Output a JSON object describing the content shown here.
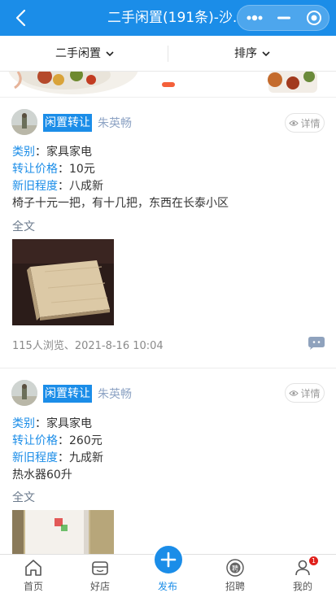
{
  "header": {
    "title": "二手闲置(191条)-沙...",
    "bg_color": "#1b8de8",
    "back_icon": "chevron-left-icon",
    "capsule_icons": [
      "more-dots-icon",
      "minimize-icon",
      "target-icon"
    ]
  },
  "filters": [
    {
      "label": "二手闲置",
      "icon": "chevron-down-icon"
    },
    {
      "label": "排序",
      "icon": "chevron-down-icon"
    }
  ],
  "posts": [
    {
      "tag": "闲置转让",
      "author": "朱英畅",
      "detail_label": "详情",
      "fields": [
        {
          "key": "类别",
          "value": "家具家电"
        },
        {
          "key": "转让价格",
          "value": "10元"
        },
        {
          "key": "新旧程度",
          "value": "八成新"
        }
      ],
      "description": "椅子十元一把，有十几把，东西在长泰小区",
      "more_label": "全文",
      "views_time": "115人浏览、2021-8-16 10:04"
    },
    {
      "tag": "闲置转让",
      "author": "朱英畅",
      "detail_label": "详情",
      "fields": [
        {
          "key": "类别",
          "value": "家具家电"
        },
        {
          "key": "转让价格",
          "value": "260元"
        },
        {
          "key": "新旧程度",
          "value": "九成新"
        }
      ],
      "description": "热水器60升",
      "more_label": "全文"
    }
  ],
  "field_separator": "：",
  "tabbar": {
    "items": [
      {
        "label": "首页",
        "icon": "home-icon"
      },
      {
        "label": "好店",
        "icon": "shop-icon"
      },
      {
        "label": "发布",
        "icon": "plus-icon",
        "active": true
      },
      {
        "label": "招聘",
        "icon": "recruit-icon"
      },
      {
        "label": "我的",
        "icon": "user-icon"
      }
    ],
    "badge_count": "1",
    "active_color": "#1b8de8"
  }
}
